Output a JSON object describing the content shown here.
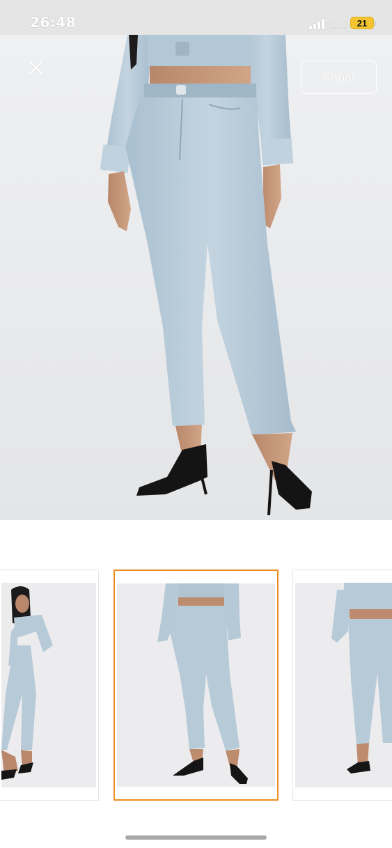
{
  "status_bar": {
    "time": "26:48",
    "network": "LTE",
    "battery": "21"
  },
  "hero": {
    "close_icon": "close-icon",
    "close_label": "Kapat"
  },
  "gallery": {
    "selected_index": 1,
    "accent_color": "#f08a1c",
    "thumbnails": [
      {
        "view": "side"
      },
      {
        "view": "front"
      },
      {
        "view": "back"
      }
    ]
  }
}
